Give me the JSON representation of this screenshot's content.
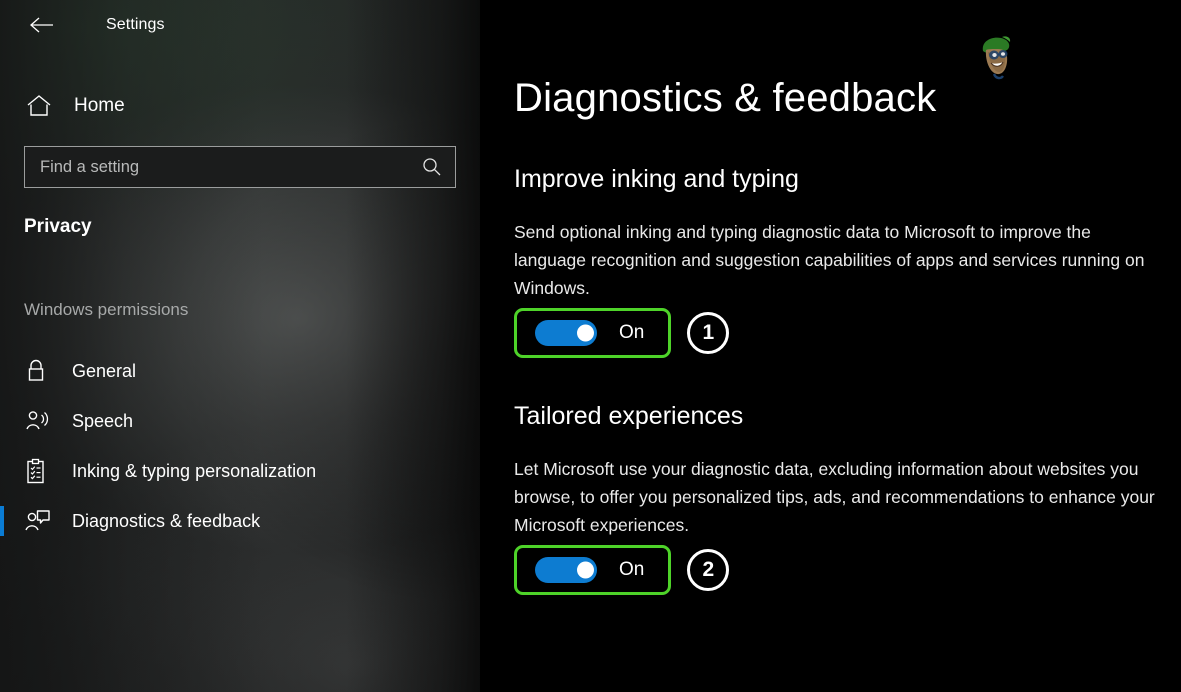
{
  "window": {
    "title": "Settings",
    "back_icon": "back-arrow-icon"
  },
  "sidebar": {
    "home": {
      "label": "Home",
      "icon": "home-icon"
    },
    "search": {
      "value": "",
      "placeholder": "Find a setting",
      "icon": "search-icon"
    },
    "category_title": "Privacy",
    "group_title": "Windows permissions",
    "items": [
      {
        "label": "General",
        "icon": "lock-icon",
        "selected": false
      },
      {
        "label": "Speech",
        "icon": "person-speaking-icon",
        "selected": false
      },
      {
        "label": "Inking & typing personalization",
        "icon": "clipboard-checklist-icon",
        "selected": false
      },
      {
        "label": "Diagnostics & feedback",
        "icon": "person-feedback-icon",
        "selected": true
      }
    ],
    "selection_color": "#0a7cd4"
  },
  "main": {
    "page_title": "Diagnostics & feedback",
    "watermark_icon": "cartoon-face-green-beret-icon",
    "sections": [
      {
        "heading": "Improve inking and typing",
        "body": "Send optional inking and typing diagnostic data to Microsoft to improve the language recognition and suggestion capabilities of apps and services running on Windows.",
        "toggle": {
          "state": "On",
          "label": "On",
          "checked": true
        },
        "step_number": "1"
      },
      {
        "heading": "Tailored experiences",
        "body": "Let Microsoft use your diagnostic data, excluding information about websites you browse, to offer you personalized tips, ads, and recommendations to enhance your Microsoft experiences.",
        "toggle": {
          "state": "On",
          "label": "On",
          "checked": true
        },
        "step_number": "2"
      }
    ]
  },
  "colors": {
    "accent_blue": "#0d7cd1",
    "highlight_green": "#4ed329",
    "background": "#000000",
    "sidebar": "#1f2120",
    "text": "#ffffff"
  }
}
